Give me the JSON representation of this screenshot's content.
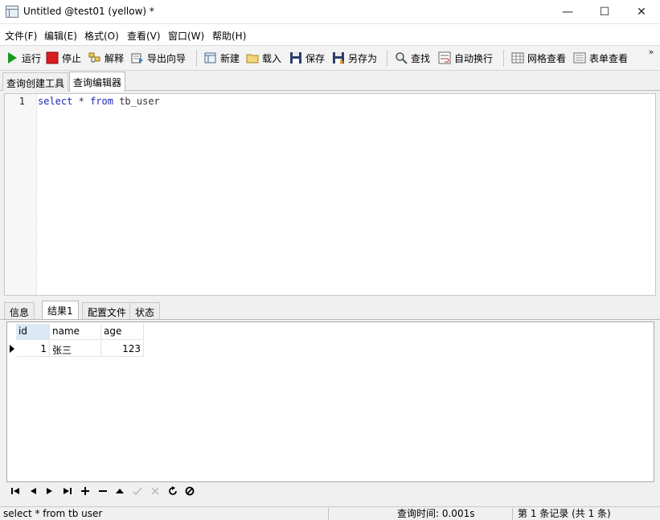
{
  "window": {
    "title": "Untitled @test01 (yellow) *",
    "minimize": "—",
    "maximize": "☐",
    "close": "✕"
  },
  "menu": [
    "文件(F)",
    "编辑(E)",
    "格式(O)",
    "查看(V)",
    "窗口(W)",
    "帮助(H)"
  ],
  "toolbar": {
    "run": "运行",
    "stop": "停止",
    "explain": "解释",
    "export_wizard": "导出向导",
    "new": "新建",
    "load": "载入",
    "save": "保存",
    "save_as": "另存为",
    "find": "查找",
    "word_wrap": "自动换行",
    "grid_view": "网格查看",
    "form_view": "表单查看",
    "more": "»",
    "colors": {
      "run": "#1a9a1a",
      "stop": "#d81e1e"
    }
  },
  "tabs": {
    "query_builder": "查询创建工具",
    "query_editor": "查询编辑器"
  },
  "editor": {
    "lines": [
      {
        "number": "1",
        "select": "select",
        "star": "*",
        "from": "from",
        "table": "tb_user"
      }
    ],
    "keyword_color": "#1c27b8"
  },
  "result_tabs": {
    "info": "信息",
    "result1": "结果1",
    "profile": "配置文件",
    "status": "状态"
  },
  "grid": {
    "columns": [
      "id",
      "name",
      "age"
    ],
    "rows": [
      {
        "id": "1",
        "name": "张三",
        "age": "123"
      }
    ]
  },
  "nav_icons": [
    "first-record-icon",
    "prev-record-icon",
    "next-record-icon",
    "last-record-icon",
    "add-record-icon",
    "delete-record-icon",
    "apply-icon",
    "commit-icon",
    "cancel-icon",
    "refresh-icon",
    "stop-icon"
  ],
  "statusbar": {
    "query": "select * from tb user",
    "query_time": "查询时间: 0.001s",
    "record_info": "第 1 条记录 (共 1 条)"
  }
}
